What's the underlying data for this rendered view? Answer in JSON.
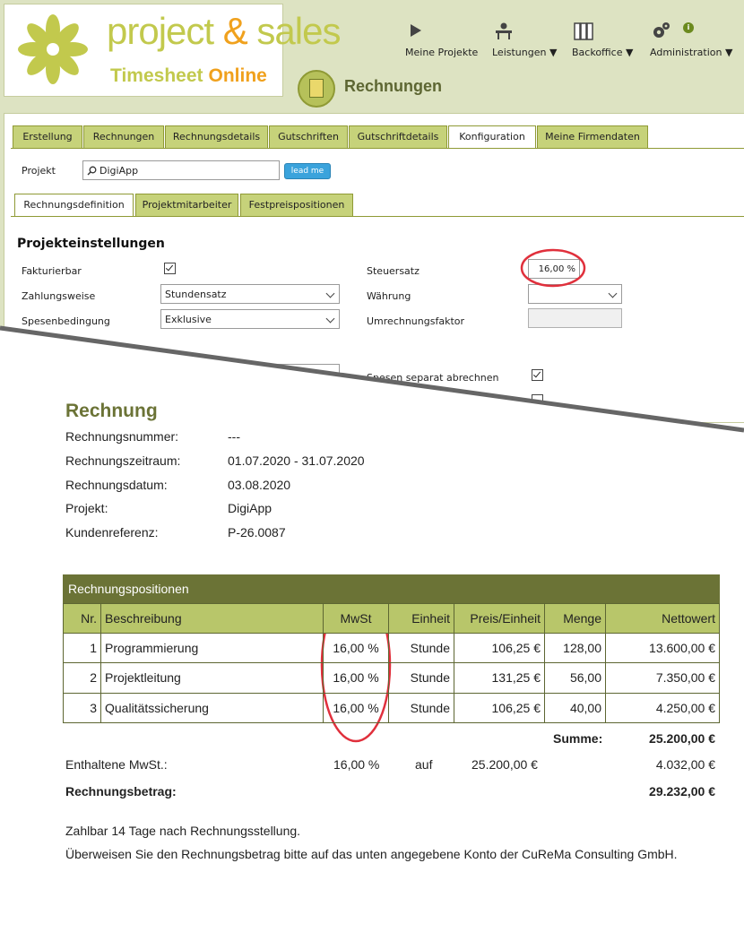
{
  "app": {
    "logo_word1": "project",
    "logo_amp": "&",
    "logo_word2": "sales",
    "logo_sub1": "Timesheet",
    "logo_sub2": "Online",
    "brand_colors": {
      "green": "#c2c94d",
      "orange": "#f0a11d",
      "dark_green": "#6b7336"
    }
  },
  "topnav": [
    {
      "label": "Meine Projekte",
      "icon": "play-icon"
    },
    {
      "label": "Leistungen ▼",
      "icon": "desk-worker-icon"
    },
    {
      "label": "Backoffice ▼",
      "icon": "binders-icon"
    },
    {
      "label": "Administration ▼",
      "icon": "gears-icon"
    }
  ],
  "page": {
    "title": "Rechnungen",
    "icon": "calculator-icon"
  },
  "main_tabs": [
    "Erstellung",
    "Rechnungen",
    "Rechnungsdetails",
    "Gutschriften",
    "Gutschriftdetails",
    "Konfiguration",
    "Meine Firmendaten"
  ],
  "main_tab_active": "Konfiguration",
  "project": {
    "label": "Projekt",
    "value": "DigiApp",
    "button": "lead me"
  },
  "sub_tabs": [
    "Rechnungsdefinition",
    "Projektmitarbeiter",
    "Festpreispositionen"
  ],
  "sub_tab_active": "Rechnungsdefinition",
  "settings": {
    "title": "Projekteinstellungen",
    "fakturierbar_label": "Fakturierbar",
    "fakturierbar_checked": true,
    "zahlungsweise_label": "Zahlungsweise",
    "zahlungsweise_value": "Stundensatz",
    "spesen_label": "Spesenbedingung",
    "spesen_value": "Exklusive",
    "steuersatz_label": "Steuersatz",
    "steuersatz_value": "16,00 %",
    "waehrung_label": "Währung",
    "waehrung_value": "",
    "umrechnung_label": "Umrechnungsfaktor",
    "umrechnung_value": "",
    "spesen_separat_label": "Spesen separat abrechnen",
    "spesen_separat_checked": true
  },
  "invoice": {
    "title": "Rechnung",
    "fields": [
      {
        "label": "Rechnungsnummer:",
        "value": "---"
      },
      {
        "label": "Rechnungszeitraum:",
        "value": "01.07.2020 - 31.07.2020"
      },
      {
        "label": "Rechnungsdatum:",
        "value": "03.08.2020"
      },
      {
        "label": "Projekt:",
        "value": "DigiApp"
      },
      {
        "label": "Kundenreferenz:",
        "value": "P-26.0087"
      }
    ],
    "table_title": "Rechnungspositionen",
    "columns": [
      "Nr.",
      "Beschreibung",
      "MwSt",
      "Einheit",
      "Preis/Einheit",
      "Menge",
      "Nettowert"
    ],
    "rows": [
      [
        "1",
        "Programmierung",
        "16,00 %",
        "Stunde",
        "106,25 €",
        "128,00",
        "13.600,00 €"
      ],
      [
        "2",
        "Projektleitung",
        "16,00 %",
        "Stunde",
        "131,25 €",
        "56,00",
        "7.350,00 €"
      ],
      [
        "3",
        "Qualitätssicherung",
        "16,00 %",
        "Stunde",
        "106,25 €",
        "40,00",
        "4.250,00 €"
      ]
    ],
    "summe_label": "Summe:",
    "summe_value": "25.200,00 €",
    "mwst_label": "Enthaltene MwSt.:",
    "mwst_rate": "16,00 %",
    "mwst_auf": "auf",
    "mwst_base": "25.200,00 €",
    "mwst_value": "4.032,00 €",
    "betrag_label": "Rechnungsbetrag:",
    "betrag_value": "29.232,00 €",
    "footer_1": "Zahlbar 14 Tage nach Rechnungsstellung.",
    "footer_2": "Überweisen Sie den Rechnungsbetrag bitte auf das unten angegebene Konto der CuReMa Consulting GmbH."
  },
  "highlight_color": "#e0303c"
}
